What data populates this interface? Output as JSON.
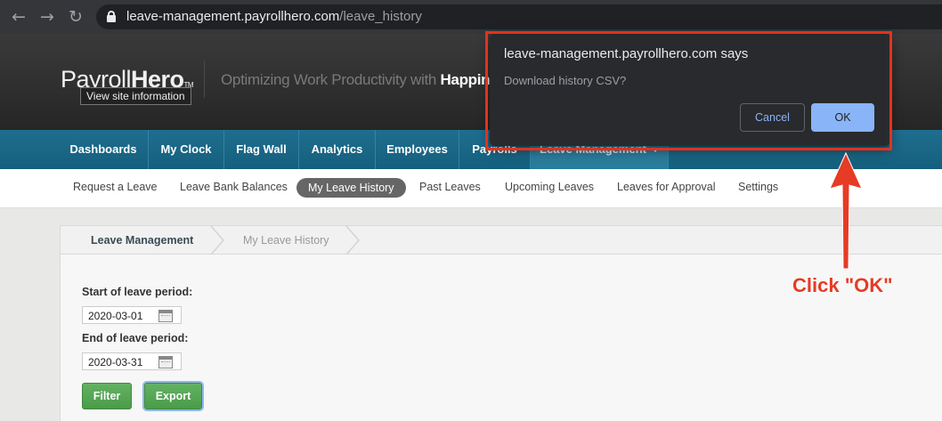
{
  "browser": {
    "url_host": "leave-management.payrollhero.com",
    "url_path": "/leave_history"
  },
  "header": {
    "logo_light": "Payroll",
    "logo_bold": "Hero",
    "logo_tm": "TM",
    "tagline": "Optimizing Work Productivity with ",
    "tagline_bold": "Happines",
    "tooltip": "View site information"
  },
  "main_nav": {
    "items": [
      {
        "label": "Dashboards"
      },
      {
        "label": "My Clock"
      },
      {
        "label": "Flag Wall"
      },
      {
        "label": "Analytics"
      },
      {
        "label": "Employees"
      },
      {
        "label": "Payrolls"
      },
      {
        "label": "Leave Management"
      }
    ],
    "active": "Leave Management"
  },
  "sub_nav": {
    "items": [
      {
        "label": "Request a Leave"
      },
      {
        "label": "Leave Bank Balances"
      },
      {
        "label": "My Leave History"
      },
      {
        "label": "Past Leaves"
      },
      {
        "label": "Upcoming Leaves"
      },
      {
        "label": "Leaves for Approval"
      },
      {
        "label": "Settings"
      }
    ],
    "active": "My Leave History"
  },
  "breadcrumb": {
    "items": [
      {
        "label": "Leave Management"
      },
      {
        "label": "My Leave History"
      }
    ]
  },
  "form": {
    "start_label": "Start of leave period:",
    "start_value": "2020-03-01",
    "end_label": "End of leave period:",
    "end_value": "2020-03-31",
    "filter_label": "Filter",
    "export_label": "Export"
  },
  "dialog": {
    "title": "leave-management.payrollhero.com says",
    "message": "Download history CSV?",
    "cancel_label": "Cancel",
    "ok_label": "OK"
  },
  "annotation": {
    "text": "Click \"OK\"",
    "color": "#e63b25"
  },
  "colors": {
    "nav_blue": "#1a6687",
    "button_green": "#55a455",
    "dialog_bg": "#292a2d",
    "ok_blue": "#8ab4f8"
  },
  "icons": [
    "back-icon",
    "forward-icon",
    "reload-icon",
    "lock-icon",
    "calendar-icon",
    "chevron-down-icon",
    "arrow-icon"
  ]
}
